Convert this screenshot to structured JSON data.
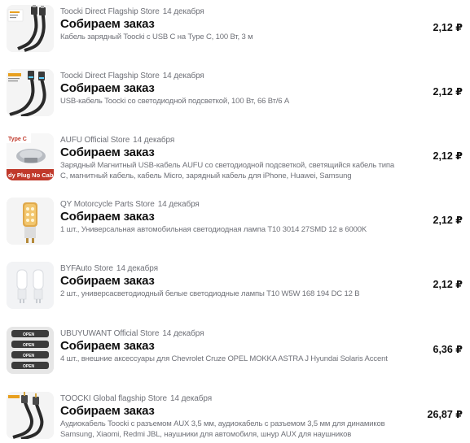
{
  "orders": [
    {
      "store": "Toocki Direct Flagship Store",
      "date": "14 декабря",
      "status": "Собираем заказ",
      "description": "Кабель зарядный Toocki с USB C на Type C, 100 Вт, 3 м",
      "price": "2,12 ₽",
      "thumb_icon": "usb-c-cable-thumbnail"
    },
    {
      "store": "Toocki Direct Flagship Store",
      "date": "14 декабря",
      "status": "Собираем заказ",
      "description": "USB-кабель Toocki со светодиодной подсветкой, 100 Вт, 66 Вт/6 А",
      "price": "2,12 ₽",
      "thumb_icon": "led-usb-cable-thumbnail"
    },
    {
      "store": "AUFU Official Store",
      "date": "14 декабря",
      "status": "Собираем заказ",
      "description": "Зарядный Магнитный USB-кабель AUFU со светодиодной подсветкой, светящийся кабель типа C, магнитный кабель, кабель Micro, зарядный кабель для iPhone, Huawei, Samsung",
      "price": "2,12 ₽",
      "thumb_icon": "magnetic-plug-thumbnail",
      "thumb_text": [
        "Type C",
        "dy Plug No Cab"
      ]
    },
    {
      "store": "QY Motorcycle Parts Store",
      "date": "14 декабря",
      "status": "Собираем заказ",
      "description": "1 шт., Универсальная автомобильная светодиодная лампа T10 3014 27SMD 12 в 6000K",
      "price": "2,12 ₽",
      "thumb_icon": "led-bulb-thumbnail"
    },
    {
      "store": "BYFAuto Store",
      "date": "14 декабря",
      "status": "Собираем заказ",
      "description": "2 шт., универсасветодиодный белые светодиодные лампы T10 W5W 168 194 DC 12 В",
      "price": "2,12 ₽",
      "thumb_icon": "white-led-bulbs-thumbnail"
    },
    {
      "store": "UBUYUWANT Official Store",
      "date": "14 декабря",
      "status": "Собираем заказ",
      "description": "4 шт., внешние аксессуары для Chevrolet Cruze OPEL MOKKA ASTRA J Hyundai Solaris Accent",
      "price": "6,36 ₽",
      "thumb_icon": "door-sticker-thumbnail",
      "thumb_text": [
        "OPEN",
        "OPEN",
        "OPEN",
        "OPEN"
      ]
    },
    {
      "store": "TOOCKI Global flagship Store",
      "date": "14 декабря",
      "status": "Собираем заказ",
      "description": "Аудиокабель Toocki с разъемом AUX 3,5 мм, аудиокабель с разъемом 3,5 мм для динамиков Samsung, Xiaomi, Redmi JBL, наушники для автомобиля, шнур AUX для наушников",
      "price": "26,87 ₽",
      "thumb_icon": "aux-cable-thumbnail"
    }
  ]
}
